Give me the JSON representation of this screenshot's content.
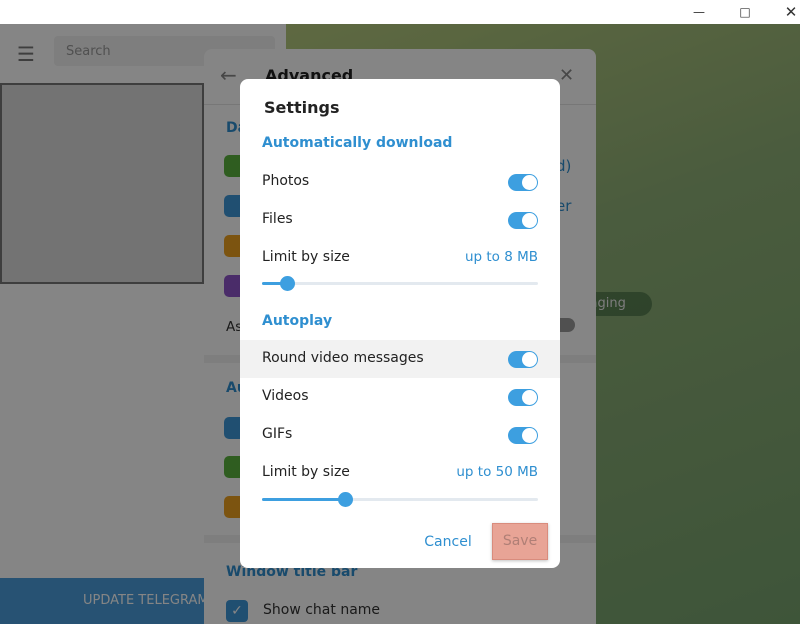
{
  "window": {
    "controls": [
      "minimize",
      "maximize",
      "close"
    ]
  },
  "sidebar": {
    "search_placeholder": "Search",
    "update_button": "UPDATE TELEGRAM"
  },
  "advanced": {
    "title": "Advanced",
    "section1": "Da",
    "label_d": "d)",
    "label_er": "er",
    "ask_label": "As",
    "section2": "Au",
    "window_title_bar": "Window title bar",
    "show_chat_name": "Show chat name",
    "icon_colors": [
      "#5bb33e",
      "#3e97d9",
      "#eea21f",
      "#8e55c9",
      "#3e97d9",
      "#5bb33e",
      "#eea21f"
    ]
  },
  "chat": {
    "badge": "ssaging"
  },
  "dialog": {
    "title": "Settings",
    "auto_download": {
      "header": "Automatically download",
      "items": [
        {
          "label": "Photos",
          "on": true
        },
        {
          "label": "Files",
          "on": true
        }
      ],
      "limit_label": "Limit by size",
      "limit_value": "up to 8 MB",
      "slider_fraction": 0.09
    },
    "autoplay": {
      "header": "Autoplay",
      "items": [
        {
          "label": "Round video messages",
          "on": true
        },
        {
          "label": "Videos",
          "on": true
        },
        {
          "label": "GIFs",
          "on": true
        }
      ],
      "limit_label": "Limit by size",
      "limit_value": "up to 50 MB",
      "slider_fraction": 0.3
    },
    "cancel": "Cancel",
    "save": "Save"
  },
  "colors": {
    "accent": "#3d9fe0",
    "save_highlight": "#e8a496"
  }
}
